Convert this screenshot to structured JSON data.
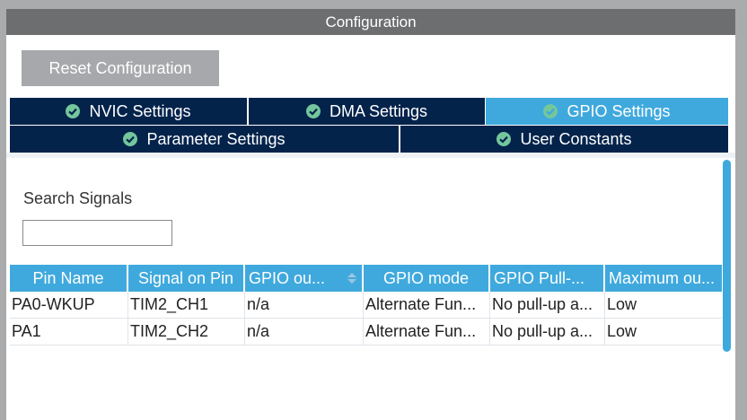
{
  "window": {
    "title": "Configuration"
  },
  "toolbar": {
    "reset_label": "Reset Configuration"
  },
  "tabs": [
    {
      "label": "NVIC Settings",
      "active": false
    },
    {
      "label": "DMA Settings",
      "active": false
    },
    {
      "label": "GPIO Settings",
      "active": true
    },
    {
      "label": "Parameter Settings",
      "active": false
    },
    {
      "label": "User Constants",
      "active": false
    }
  ],
  "search": {
    "label": "Search Signals",
    "value": "",
    "placeholder": ""
  },
  "table": {
    "headers": [
      "Pin Name",
      "Signal on Pin",
      "GPIO ou...",
      "GPIO mode",
      "GPIO Pull-...",
      "Maximum ou..."
    ],
    "rows": [
      [
        "PA0-WKUP",
        "TIM2_CH1",
        "n/a",
        "Alternate Fun...",
        "No pull-up a...",
        "Low"
      ],
      [
        "PA1",
        "TIM2_CH2",
        "n/a",
        "Alternate Fun...",
        "No pull-up a...",
        "Low"
      ]
    ]
  },
  "colors": {
    "tab_dark": "#03234b",
    "tab_active": "#3fa9dd",
    "title_bar": "#6d6e70",
    "check_green": "#74c69c"
  }
}
